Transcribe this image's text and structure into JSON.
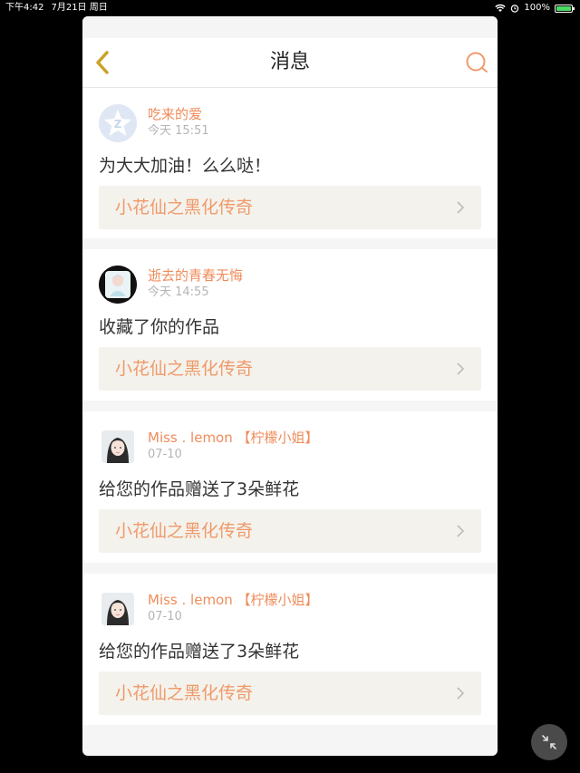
{
  "status_bar": {
    "time": "下午4:42",
    "date": "7月21日 周日",
    "battery": "100%",
    "battery_level": 1.0
  },
  "nav": {
    "title": "消息",
    "back_icon": "chevron-left-icon",
    "search_icon": "search-icon"
  },
  "messages": [
    {
      "avatar": "qq-default-avatar",
      "username": "吃来的爱",
      "time": "今天 15:51",
      "text": "为大大加油！么么哒！",
      "work_title": "小花仙之黑化传奇"
    },
    {
      "avatar": "girl-avatar",
      "username": "逝去的青春无悔",
      "time": "今天 14:55",
      "text": "收藏了你的作品",
      "work_title": "小花仙之黑化传奇"
    },
    {
      "avatar": "girl-portrait-avatar",
      "username": "Miss . lemon 【柠檬小姐】",
      "time": "07-10",
      "text": "给您的作品赠送了3朵鲜花",
      "work_title": "小花仙之黑化传奇"
    },
    {
      "avatar": "girl-portrait-avatar",
      "username": "Miss . lemon 【柠檬小姐】",
      "time": "07-10",
      "text": "给您的作品赠送了3朵鲜花",
      "work_title": "小花仙之黑化传奇"
    }
  ],
  "colors": {
    "accent": "#ef8c5b",
    "back_icon": "#c9a227",
    "card_bg": "#ffffff",
    "link_bg": "#f4f2ec"
  }
}
